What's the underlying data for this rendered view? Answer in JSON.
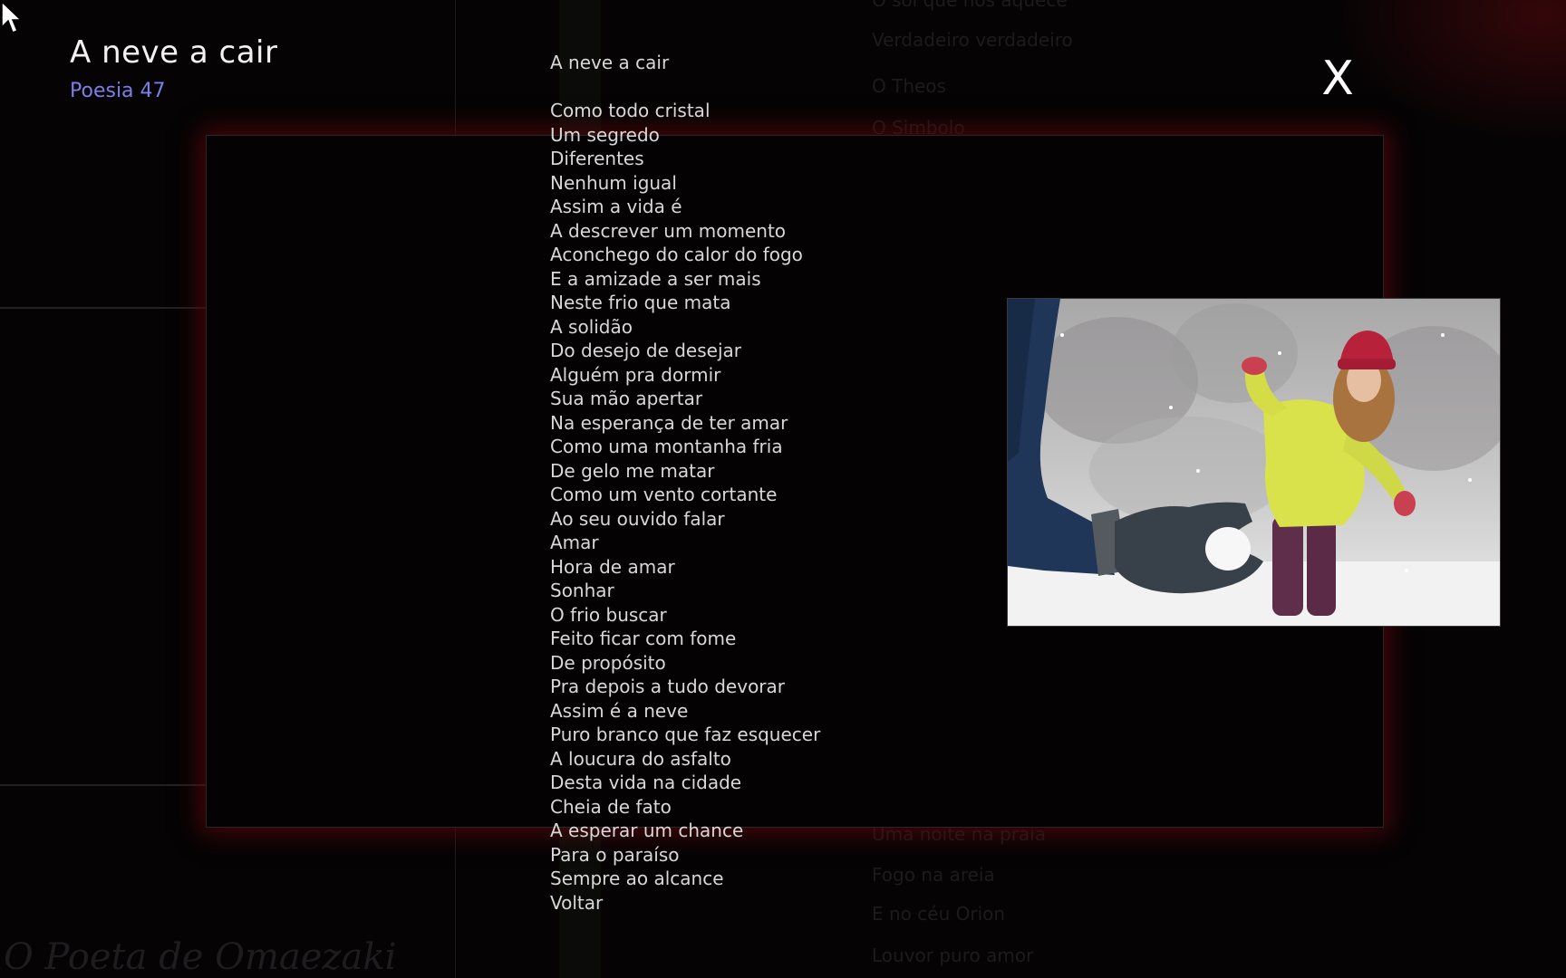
{
  "window": {
    "title": "A neve a cair",
    "subtitle": "Poesia 47",
    "close_label": "X"
  },
  "background": {
    "menu_items_top": [
      "O sol que nos aquece",
      "Verdadeiro  verdadeiro",
      "O Theos",
      "O Simbolo"
    ],
    "menu_items_bottom": [
      "Uma noite na praia",
      "Fogo na areia",
      "E no céu Orion",
      "Louvor puro amor"
    ],
    "footer_title": "O Poeta de Omaezaki"
  },
  "poem": {
    "heading": "A neve a cair",
    "lines": [
      "Como todo cristal",
      "Um segredo",
      "Diferentes",
      "Nenhum igual",
      "Assim a vida é",
      "A descrever um momento",
      "Aconchego do calor do fogo",
      "E a amizade a ser mais",
      "Neste frio que mata",
      "A solidão",
      "Do desejo de desejar",
      "Alguém pra dormir",
      "Sua mão apertar",
      "Na esperança de ter amar",
      "Como uma montanha fria",
      "De gelo me matar",
      "Como um vento cortante",
      "Ao seu ouvido falar",
      "Amar",
      "Hora de amar",
      "Sonhar",
      "O frio buscar",
      "Feito ficar com fome",
      "De propósito",
      "Pra depois a tudo devorar",
      "Assim é a neve",
      "Puro branco que faz esquecer",
      "A loucura do asfalto",
      "Desta vida na cidade",
      "Cheia de fato",
      "A esperar um chance",
      "Para o paraíso",
      "Sempre ao alcance"
    ],
    "back_label": "Voltar"
  },
  "colors": {
    "subtitle": "#7d7ee8",
    "panel_glow": "#5f080c",
    "text": "#d8d8d8"
  },
  "icons": {
    "cursor": "arrow-pointer-icon",
    "close": "close-icon"
  }
}
